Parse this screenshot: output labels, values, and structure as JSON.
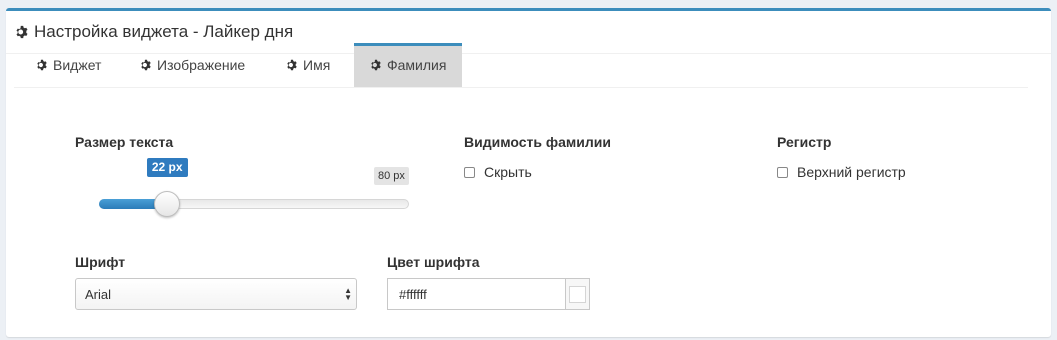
{
  "header": {
    "title": "Настройка виджета - Лайкер дня",
    "icon": "gear-icon"
  },
  "tabs": [
    {
      "label": "Виджет",
      "icon": "gear-icon",
      "active": false
    },
    {
      "label": "Изображение",
      "icon": "gear-icon",
      "active": false
    },
    {
      "label": "Имя",
      "icon": "gear-icon",
      "active": false
    },
    {
      "label": "Фамилия",
      "icon": "gear-icon",
      "active": true
    }
  ],
  "text_size": {
    "label": "Размер текста",
    "current_label": "22 px",
    "max_label": "80 px",
    "value": 22,
    "min": 8,
    "max": 80
  },
  "surname_visibility": {
    "label": "Видимость фамилии",
    "checkbox_label": "Скрыть",
    "checked": false
  },
  "register": {
    "label": "Регистр",
    "checkbox_label": "Верхний регистр",
    "checked": false
  },
  "font": {
    "label": "Шрифт",
    "selected": "Arial"
  },
  "font_color": {
    "label": "Цвет шрифта",
    "value": "#ffffff"
  },
  "colors": {
    "accent": "#3c8dbc",
    "badge": "#2f7bbf",
    "active_tab_bg": "#d9d9d9"
  }
}
